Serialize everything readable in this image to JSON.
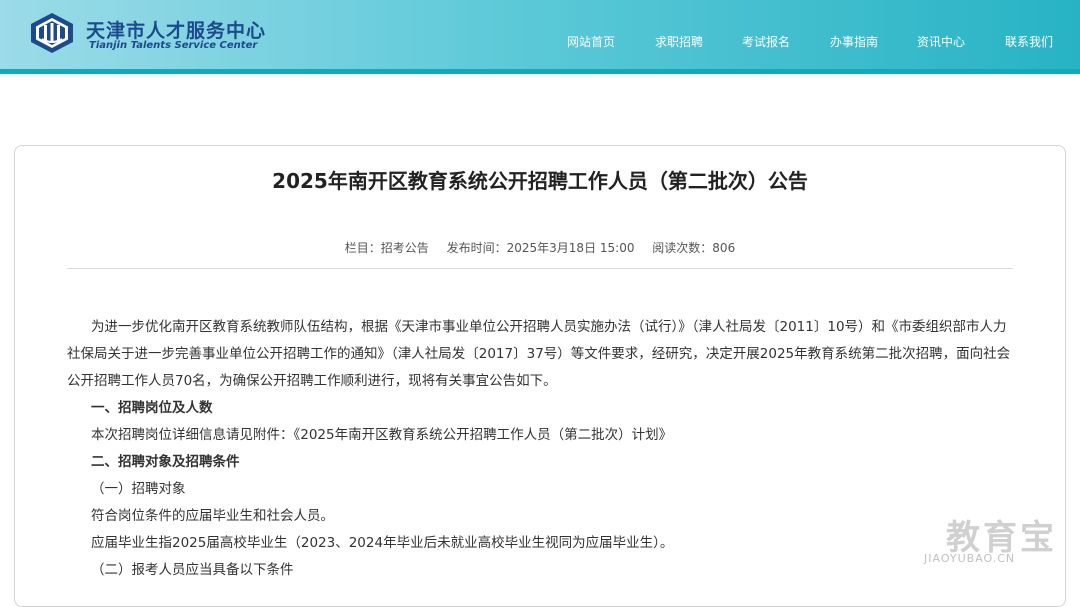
{
  "header": {
    "brand_cn": "天津市人才服务中心",
    "brand_en": "Tianjin Talents Service Center",
    "nav": [
      "网站首页",
      "求职招聘",
      "考试报名",
      "办事指南",
      "资讯中心",
      "联系我们"
    ]
  },
  "article": {
    "title": "2025年南开区教育系统公开招聘工作人员（第二批次）公告",
    "meta": {
      "column": "栏目：招考公告",
      "published": "发布时间：2025年3月18日 15:00",
      "views": "阅读次数：806"
    },
    "intro": "为进一步优化南开区教育系统教师队伍结构，根据《天津市事业单位公开招聘人员实施办法（试行）》（津人社局发〔2011〕10号）和《市委组织部市人力社保局关于进一步完善事业单位公开招聘工作的通知》（津人社局发〔2017〕37号）等文件要求，经研究，决定开展2025年教育系统第二批次招聘，面向社会公开招聘工作人员70名，为确保公开招聘工作顺利进行，现将有关事宜公告如下。",
    "section1_heading": "一、招聘岗位及人数",
    "section1_text": "本次招聘岗位详细信息请见附件：《2025年南开区教育系统公开招聘工作人员（第二批次）计划》",
    "section2_heading": "二、招聘对象及招聘条件",
    "sub1": "（一）招聘对象",
    "sub1_text1": "符合岗位条件的应届毕业生和社会人员。",
    "sub1_text2": "应届毕业生指2025届高校毕业生（2023、2024年毕业后未就业高校毕业生视同为应届毕业生）。",
    "sub2": "（二）报考人员应当具备以下条件"
  },
  "watermark": {
    "cn": "教育宝",
    "en": "JIAOYUBAO.CN"
  },
  "colors": {
    "header_start": "#9cdbe8",
    "header_end": "#27b3c4",
    "brand": "#1c4a8c"
  }
}
